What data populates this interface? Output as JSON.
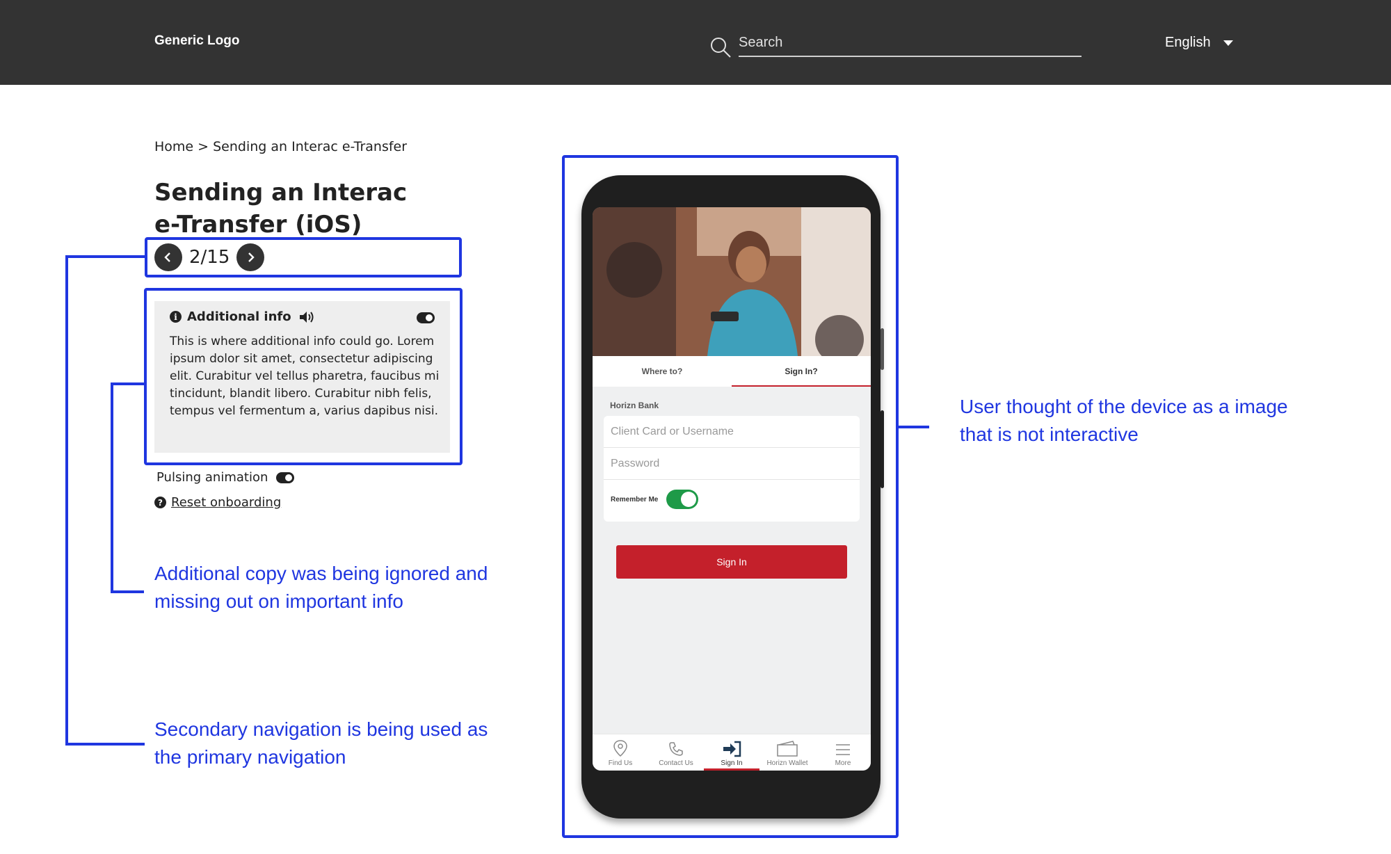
{
  "header": {
    "logo": "Generic Logo",
    "search_placeholder": "Search",
    "language": "English"
  },
  "breadcrumb": "Home > Sending an Interac e-Transfer",
  "page_title": "Sending an Interac e-Transfer (iOS)",
  "pager": {
    "count": "2/15"
  },
  "info_panel": {
    "title": "Additional info",
    "body": "This is where additional info could go. Lorem ipsum dolor sit amet, consectetur adipiscing elit. Curabitur vel tellus pharetra, faucibus mi tincidunt, blandit libero. Curabitur nibh felis, tempus vel fermentum a, varius dapibus nisi."
  },
  "pulsing_animation_label": "Pulsing animation",
  "reset_onboarding_label": "Reset onboarding",
  "annotations": {
    "additional_copy": "Additional copy was being ignored and missing out on important info",
    "secondary_nav": "Secondary navigation is being used as the primary navigation",
    "device": "User thought of the device as a image that is not interactive"
  },
  "phone_app": {
    "tabs": [
      "Where to?",
      "Sign In?"
    ],
    "active_tab": "Sign In?",
    "bank_name": "Horizn Bank",
    "username_placeholder": "Client Card or Username",
    "password_placeholder": "Password",
    "remember_me": "Remember Me",
    "sign_in_button": "Sign In",
    "bottom_nav": [
      "Find Us",
      "Contact Us",
      "Sign In",
      "Horizn Wallet",
      "More"
    ],
    "accent_color": "#c4202b",
    "toggle_color": "#1e9a48"
  },
  "colors": {
    "header_bg": "#333333",
    "annotation_blue": "#1f36e0"
  }
}
